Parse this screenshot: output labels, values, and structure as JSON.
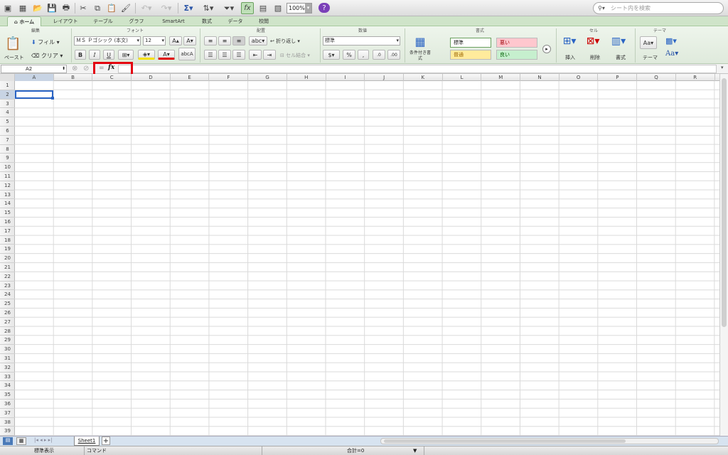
{
  "toolbar": {
    "zoom": "100%",
    "search_placeholder": "シート内を検索"
  },
  "tabs": [
    {
      "label": "ホーム",
      "active": true
    },
    {
      "label": "レイアウト"
    },
    {
      "label": "テーブル"
    },
    {
      "label": "グラフ"
    },
    {
      "label": "SmartArt"
    },
    {
      "label": "数式"
    },
    {
      "label": "データ"
    },
    {
      "label": "校閲"
    }
  ],
  "ribbon": {
    "groups": {
      "edit": "編集",
      "font": "フォント",
      "align": "配置",
      "number": "数値",
      "format": "書式",
      "cells": "セル",
      "theme": "テーマ"
    },
    "paste": "ペースト",
    "fill": "フィル",
    "clear": "クリア",
    "font_name": "ＭＳ Ｐゴシック (本文)",
    "font_size": "12",
    "wrap": "折り返し",
    "merge": "セル結合",
    "abc": "abc",
    "number_format": "標準",
    "cond_format": "条件付き書式",
    "styles": {
      "normal": "標準",
      "bad": "悪い",
      "neutral": "普通",
      "good": "良い"
    },
    "insert": "挿入",
    "delete": "削除",
    "format": "書式",
    "theme": "テーマ",
    "aa": "Aa"
  },
  "formula_bar": {
    "name_box": "A2",
    "fx": "fx",
    "value": ""
  },
  "columns": [
    "A",
    "B",
    "C",
    "D",
    "E",
    "F",
    "G",
    "H",
    "I",
    "J",
    "K",
    "L",
    "M",
    "N",
    "O",
    "P",
    "Q",
    "R"
  ],
  "rows": [
    "1",
    "2",
    "3",
    "4",
    "5",
    "6",
    "7",
    "8",
    "9",
    "10",
    "11",
    "12",
    "13",
    "14",
    "15",
    "16",
    "17",
    "18",
    "19",
    "20",
    "21",
    "22",
    "23",
    "24",
    "25",
    "26",
    "27",
    "28",
    "29",
    "30",
    "31",
    "32",
    "33",
    "34",
    "35",
    "36",
    "37",
    "38",
    "39"
  ],
  "sheets": [
    "Sheet1"
  ],
  "status": {
    "view": "標準表示",
    "mode": "コマンド",
    "sum": "合計=0"
  },
  "colors": {
    "accent": "#2a64c4",
    "highlight": "#e3000f"
  }
}
